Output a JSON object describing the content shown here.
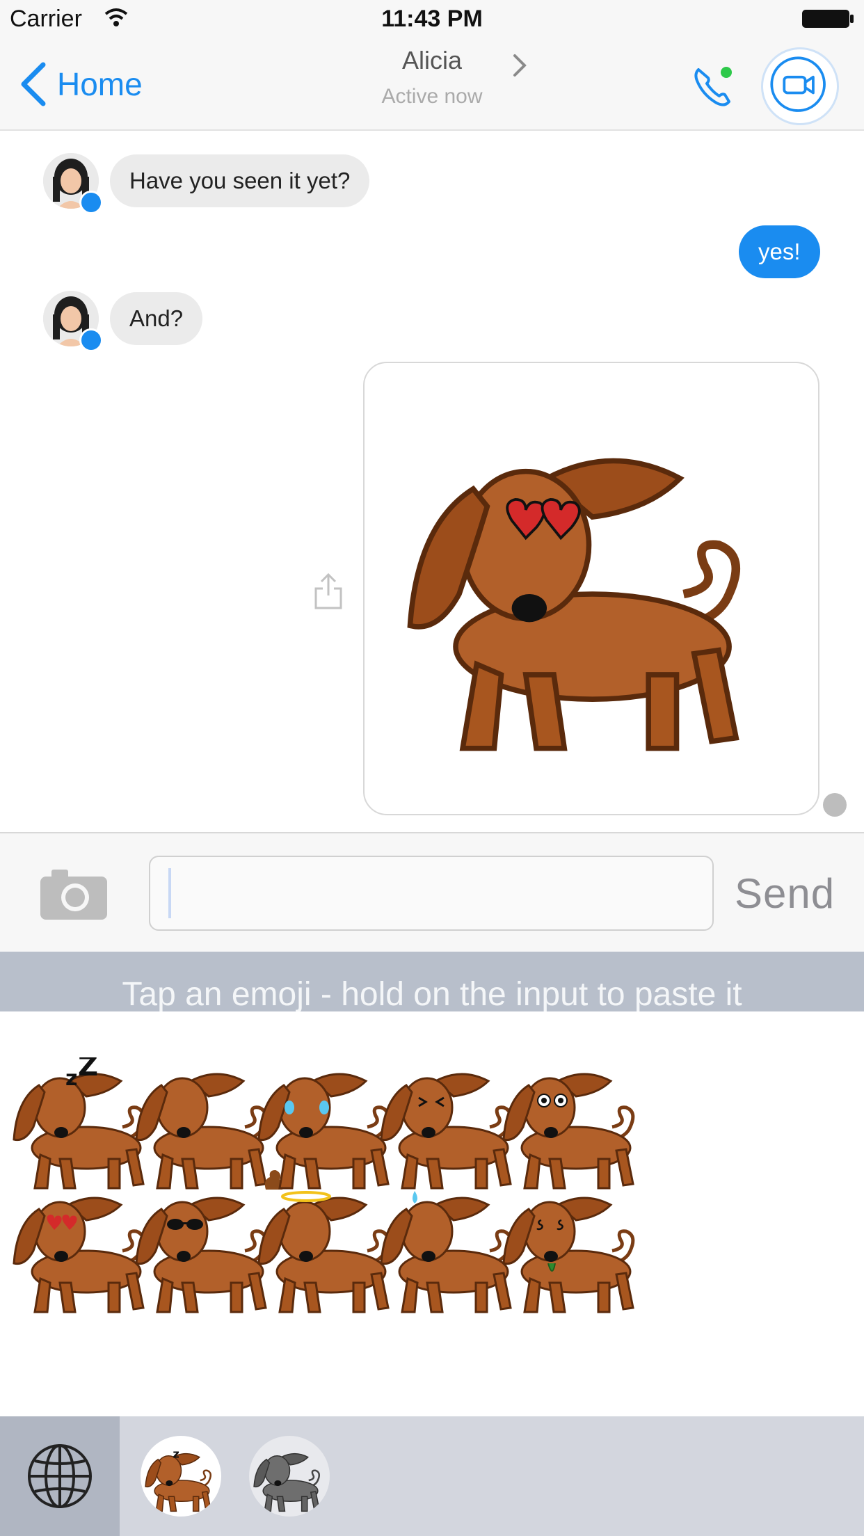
{
  "status_bar": {
    "carrier": "Carrier",
    "time": "11:43 PM"
  },
  "nav": {
    "back_label": "Home",
    "contact_name": "Alicia",
    "contact_status": "Active now"
  },
  "messages": [
    {
      "direction": "incoming",
      "text": "Have you seen it yet?"
    },
    {
      "direction": "outgoing",
      "text": "yes!"
    },
    {
      "direction": "incoming",
      "text": "And?"
    },
    {
      "direction": "outgoing",
      "type": "sticker",
      "sticker": "dachshund-heart-eyes"
    }
  ],
  "composer": {
    "value": "",
    "placeholder": "",
    "send_label": "Send"
  },
  "hint": "Tap an emoji - hold on the input to paste it",
  "sticker_grid": [
    "dachshund-sleeping",
    "dachshund-poop",
    "dachshund-crying-laughing",
    "dachshund-squinting",
    "dachshund-wide-eyes",
    "dachshund-heart-eyes",
    "dachshund-sunglasses",
    "dachshund-halo",
    "dachshund-sweat",
    "dachshund-money-eyes"
  ],
  "sticker_packs": [
    "dachshund-brown-pack",
    "dachshund-grey-pack"
  ],
  "colors": {
    "accent": "#1a8cf0",
    "online": "#2ec94a",
    "bubble_incoming": "#ebebeb",
    "hint_bar": "#b8bfcb",
    "dog_brown": "#b2602a"
  }
}
